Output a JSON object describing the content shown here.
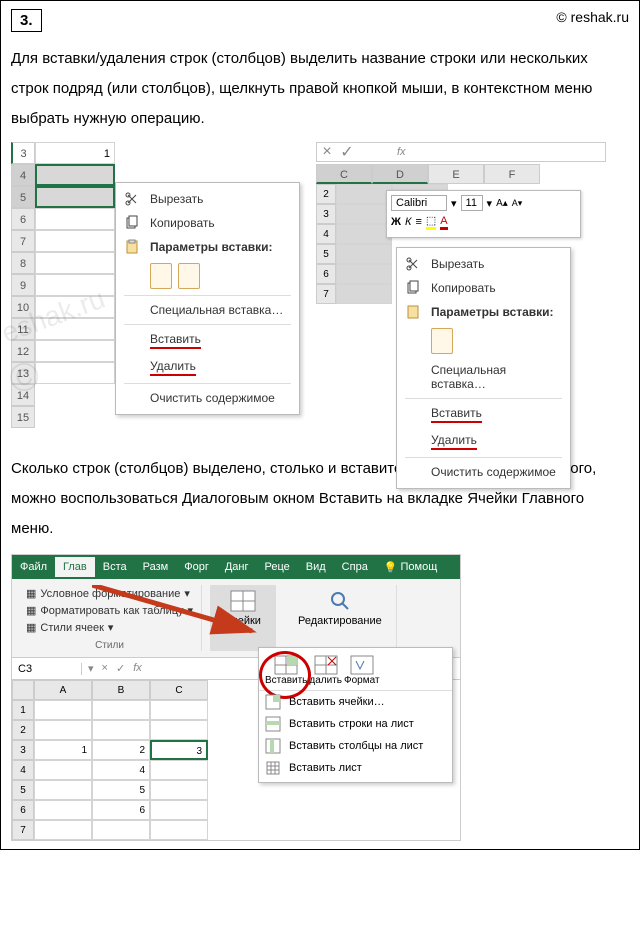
{
  "header": {
    "qnum": "3.",
    "site": "© reshak.ru"
  },
  "para1": "Для вставки/удаления строк (столбцов) выделить название строки или нескольких строк подряд (или столбцов), щелкнуть правой кнопкой мыши, в контекстном меню выбрать нужную операцию.",
  "para2": "Сколько строк (столбцов) выделено, столько и вставится или удалится. Кроме того, можно воспользоваться Диалоговым окном Вставить на вкладке Ячейки Главного меню.",
  "shot1": {
    "rows": [
      "3",
      "4",
      "5",
      "6",
      "7",
      "8",
      "9",
      "10",
      "11",
      "12",
      "13",
      "14",
      "15"
    ],
    "cell_a3": "1",
    "ctx": {
      "cut": "Вырезать",
      "copy": "Копировать",
      "paste_opts": "Параметры вставки:",
      "paste_special": "Специальная вставка…",
      "insert": "Вставить",
      "delete": "Удалить",
      "clear": "Очистить содержимое"
    }
  },
  "shot2": {
    "cols": [
      "C",
      "D",
      "E",
      "F"
    ],
    "fx": "fx",
    "rows": [
      "2",
      "3",
      "4",
      "5",
      "6",
      "7"
    ],
    "font": "Calibri",
    "fontsize": "11",
    "bold": "Ж",
    "italic": "К",
    "ctx": {
      "cut": "Вырезать",
      "copy": "Копировать",
      "paste_opts": "Параметры вставки:",
      "paste_special": "Специальная вставка…",
      "insert": "Вставить",
      "delete": "Удалить",
      "clear": "Очистить содержимое"
    }
  },
  "ribbon": {
    "tabs": [
      "Файл",
      "Глав",
      "Вста",
      "Разм",
      "Форг",
      "Данг",
      "Реце",
      "Вид",
      "Спра"
    ],
    "help": "Помощ",
    "active_tab": 1,
    "styles_group": {
      "cond_fmt": "Условное форматирование",
      "fmt_table": "Форматировать как таблицу",
      "cell_styles": "Стили ячеек",
      "label": "Стили"
    },
    "cells_label": "Ячейки",
    "edit_label": "Редактирование",
    "namebox": "C3",
    "cols": [
      "A",
      "B",
      "C"
    ],
    "rows": [
      "1",
      "2",
      "3",
      "4",
      "5",
      "6",
      "7"
    ],
    "vals": {
      "a3": "1",
      "b3": "2",
      "c3": "3",
      "b4": "4",
      "b5": "5",
      "b6": "6"
    },
    "dropdown": {
      "insert": "Вставить",
      "delete": "далить",
      "format": "Формат",
      "insert_cells": "Вставить ячейки…",
      "insert_rows": "Вставить строки на лист",
      "insert_cols": "Вставить столбцы на лист",
      "insert_sheet": "Вставить лист"
    }
  },
  "watermark": "reshak.ru"
}
